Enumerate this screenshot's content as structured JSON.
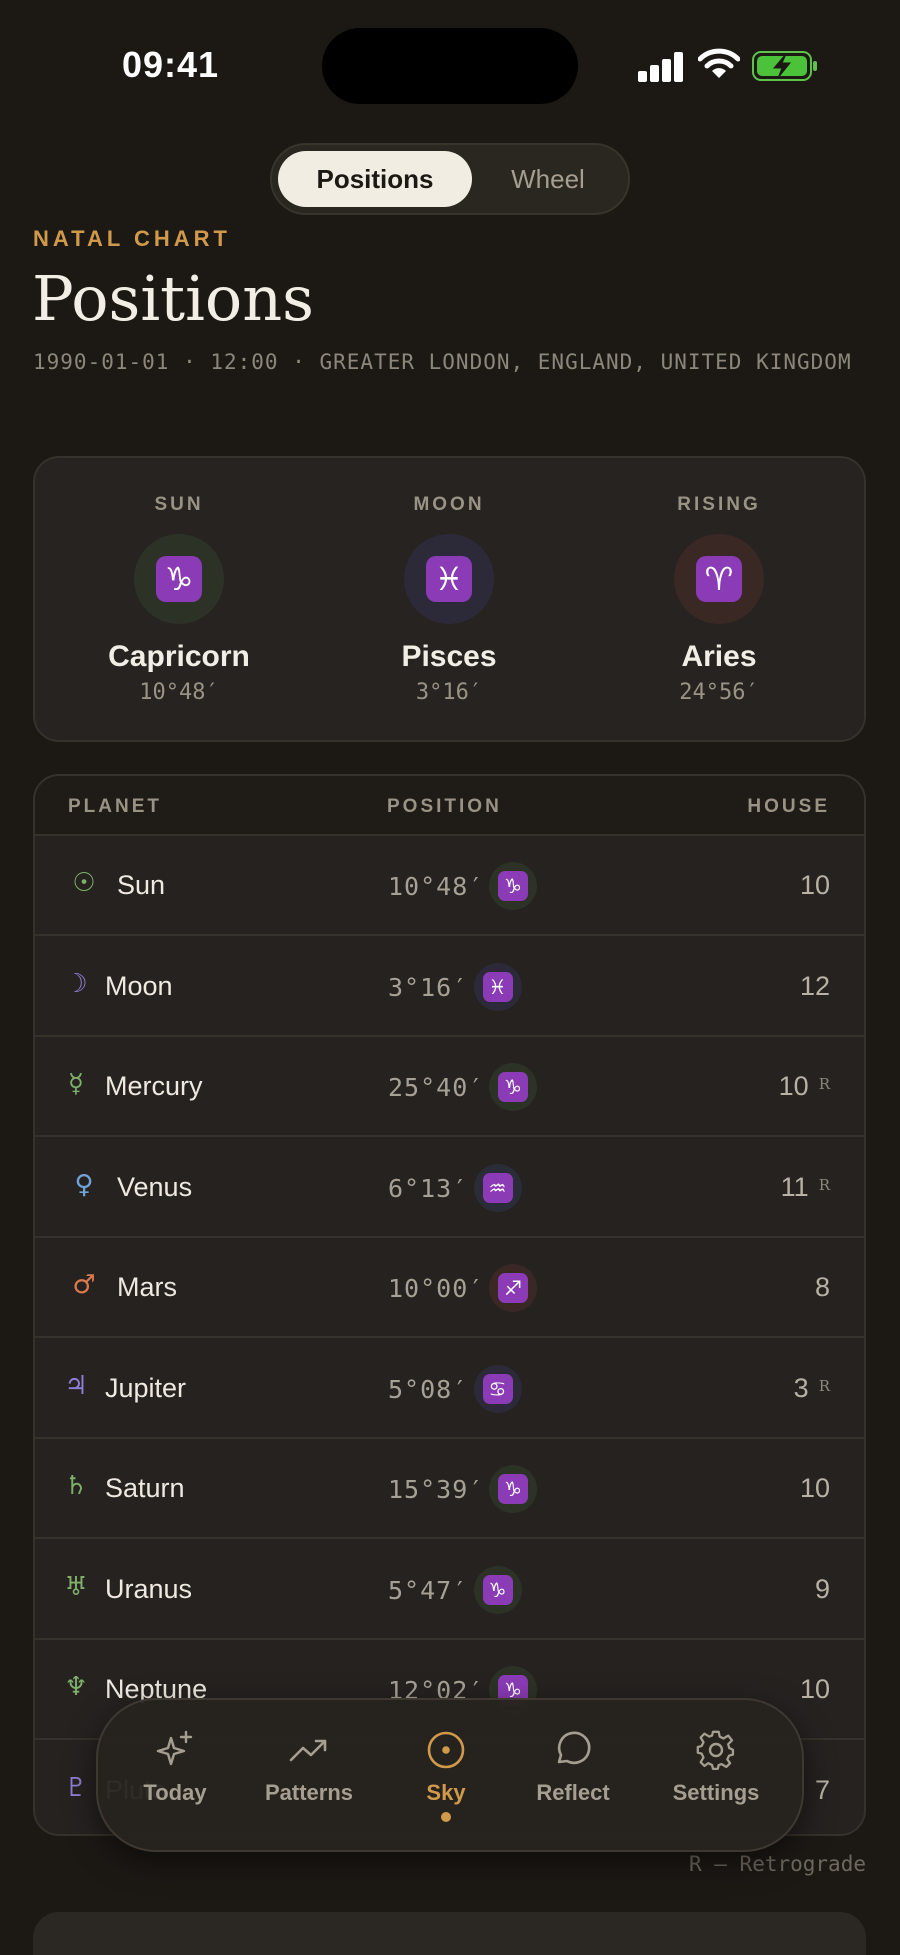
{
  "status": {
    "time": "09:41"
  },
  "segmented": {
    "positions": "Positions",
    "wheel": "Wheel"
  },
  "header": {
    "eyebrow": "NATAL CHART",
    "title": "Positions",
    "subtitle": "1990-01-01 · 12:00 · GREATER LONDON, ENGLAND, UNITED KINGDOM"
  },
  "big3": [
    {
      "label": "SUN",
      "glyph": "♑",
      "sign": "Capricorn",
      "degree": "10°48′",
      "bg": "#2c3326"
    },
    {
      "label": "MOON",
      "glyph": "♓",
      "sign": "Pisces",
      "degree": "3°16′",
      "bg": "#2c2a38"
    },
    {
      "label": "RISING",
      "glyph": "♈",
      "sign": "Aries",
      "degree": "24°56′",
      "bg": "#3a2824"
    }
  ],
  "table": {
    "headers": {
      "planet": "PLANET",
      "position": "POSITION",
      "house": "HOUSE"
    },
    "rows": [
      {
        "icon": "☉",
        "icon_color": "#7fb06a",
        "name": "Sun",
        "degree": "10°48′",
        "glyph": "♑",
        "sign_bg": "#2c3326",
        "house": "10",
        "retro": ""
      },
      {
        "icon": "☽",
        "icon_color": "#8e7fd6",
        "name": "Moon",
        "degree": "3°16′",
        "glyph": "♓",
        "sign_bg": "#2c2a38",
        "house": "12",
        "retro": ""
      },
      {
        "icon": "☿",
        "icon_color": "#7fb06a",
        "name": "Mercury",
        "degree": "25°40′",
        "glyph": "♑",
        "sign_bg": "#2c3326",
        "house": "10",
        "retro": "R"
      },
      {
        "icon": "♀",
        "icon_color": "#6fa3d8",
        "name": "Venus",
        "degree": "6°13′",
        "glyph": "♒",
        "sign_bg": "#2a2d38",
        "house": "11",
        "retro": "R"
      },
      {
        "icon": "♂",
        "icon_color": "#d97a4e",
        "name": "Mars",
        "degree": "10°00′",
        "glyph": "♐",
        "sign_bg": "#3a2824",
        "house": "8",
        "retro": ""
      },
      {
        "icon": "♃",
        "icon_color": "#8e7fd6",
        "name": "Jupiter",
        "degree": "5°08′",
        "glyph": "♋",
        "sign_bg": "#2c2a38",
        "house": "3",
        "retro": "R"
      },
      {
        "icon": "♄",
        "icon_color": "#7fb06a",
        "name": "Saturn",
        "degree": "15°39′",
        "glyph": "♑",
        "sign_bg": "#2c3326",
        "house": "10",
        "retro": ""
      },
      {
        "icon": "♅",
        "icon_color": "#7fb06a",
        "name": "Uranus",
        "degree": "5°47′",
        "glyph": "♑",
        "sign_bg": "#2c3326",
        "house": "9",
        "retro": ""
      },
      {
        "icon": "♆",
        "icon_color": "#7fb06a",
        "name": "Neptune",
        "degree": "12°02′",
        "glyph": "♑",
        "sign_bg": "#2c3326",
        "house": "10",
        "retro": ""
      },
      {
        "icon": "♇",
        "icon_color": "#8e7fd6",
        "name": "Pluto",
        "degree": "",
        "glyph": "",
        "sign_bg": "",
        "house": "7",
        "retro": ""
      }
    ]
  },
  "legend": "R — Retrograde",
  "tabbar": {
    "today": "Today",
    "patterns": "Patterns",
    "sky": "Sky",
    "reflect": "Reflect",
    "settings": "Settings"
  },
  "colors": {
    "accent": "#d19a4b",
    "background": "#1c1915",
    "glyph": "#8a3bb5"
  }
}
